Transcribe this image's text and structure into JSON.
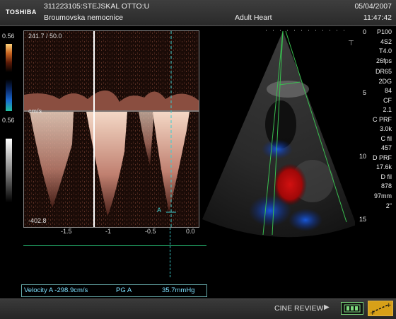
{
  "header": {
    "brand": "TOSHIBA",
    "patient": "311223105:STEJSKAL OTTO:U",
    "hospital": "Broumovska nemocnice",
    "preset": "Adult Heart",
    "date": "05/04/2007",
    "time": "11:47:42"
  },
  "scales": {
    "top_label": "0.56",
    "bottom_label": "0.56"
  },
  "spectrum": {
    "readout": "241.7 / 50.0",
    "baseline_label": "cm/s",
    "bottom_value": "-402.8",
    "marker_label": "A",
    "time_ticks": [
      "-1.5",
      "-1",
      "-0.5",
      "0.0"
    ]
  },
  "params": {
    "lines": [
      "P100",
      "4S2",
      "T4.0",
      "26fps",
      "DR65",
      "2DG",
      "84",
      "CF",
      "2.1",
      "C PRF",
      "3.0k",
      "C fil",
      "457",
      "D PRF",
      "17.6k",
      "D fil",
      "878",
      "97mm",
      "2\""
    ]
  },
  "depth_labels": [
    "0",
    "5",
    "10",
    "15"
  ],
  "measurement": {
    "velocity": "Velocity A -298.9cm/s",
    "pg_label": "PG A",
    "pg_value": "35.7mmHg"
  },
  "footer": {
    "cine_label": "CINE REVIEW",
    "play_icon": "play-icon",
    "cine_icon": "film-strip-icon",
    "caliper_icon": "caliper-icon"
  }
}
